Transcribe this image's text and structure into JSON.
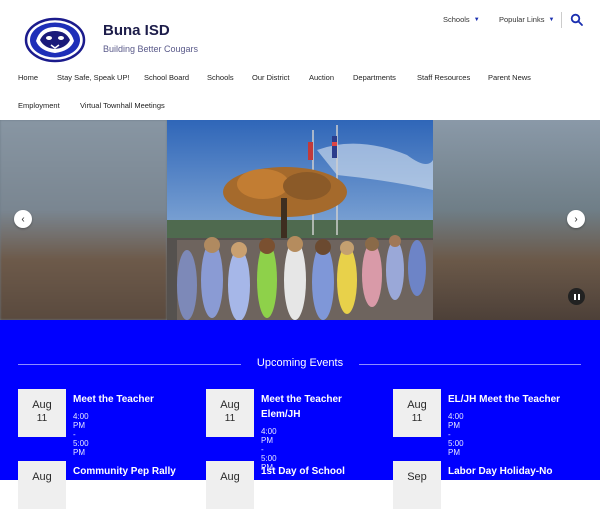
{
  "header": {
    "site_name": "Buna ISD",
    "tagline": "Building Better Cougars",
    "utility": [
      {
        "label": "Schools"
      },
      {
        "label": "Popular Links"
      }
    ]
  },
  "nav": [
    {
      "label": "Home"
    },
    {
      "label": "Stay Safe, Speak UP!"
    },
    {
      "label": "School Board"
    },
    {
      "label": "Schools"
    },
    {
      "label": "Our District"
    },
    {
      "label": "Auction"
    },
    {
      "label": "Departments"
    },
    {
      "label": "Staff Resources"
    },
    {
      "label": "Parent News"
    },
    {
      "label": "Employment"
    },
    {
      "label": "Virtual Townhall Meetings"
    }
  ],
  "slider": {
    "prev_icon": "chevron-left-icon",
    "next_icon": "chevron-right-icon",
    "pause_icon": "pause-icon"
  },
  "events": {
    "title": "Upcoming Events",
    "items": [
      {
        "month": "Aug",
        "day": "11",
        "title": "Meet the Teacher",
        "time": "4:00 PM - 5:00 PM"
      },
      {
        "month": "Aug",
        "day": "11",
        "title": "Meet the Teacher Elem/JH",
        "time": "4:00 PM - 5:00 PM"
      },
      {
        "month": "Aug",
        "day": "11",
        "title": "EL/JH Meet the Teacher",
        "time": "4:00 PM - 5:00 PM"
      },
      {
        "month": "Aug",
        "day": "",
        "title": "Community Pep Rally",
        "time": ""
      },
      {
        "month": "Aug",
        "day": "",
        "title": "1st Day of School",
        "time": ""
      },
      {
        "month": "Sep",
        "day": "",
        "title": "Labor Day Holiday-No",
        "time": ""
      }
    ]
  },
  "colors": {
    "events_bg": "#0000ff",
    "accent": "#1a2fb0"
  }
}
